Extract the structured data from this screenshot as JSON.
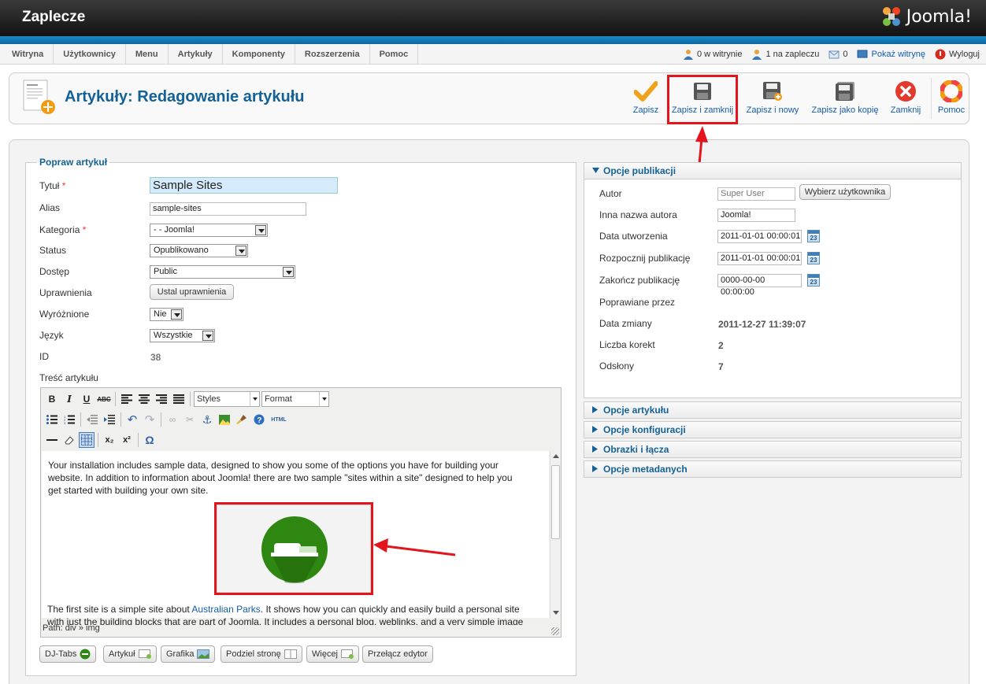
{
  "header": {
    "title": "Zaplecze",
    "logo_text": "Joomla!"
  },
  "menu": {
    "items": [
      "Witryna",
      "Użytkownicy",
      "Menu",
      "Artykuły",
      "Komponenty",
      "Rozszerzenia",
      "Pomoc"
    ]
  },
  "status": {
    "site_users": "0 w witrynie",
    "admin_users": "1 na zapleczu",
    "messages": "0",
    "show_site": "Pokaż witrynę",
    "logout": "Wyloguj"
  },
  "toolbar": {
    "page_title": "Artykuły: Redagowanie artykułu",
    "save": "Zapisz",
    "save_close": "Zapisz i zamknij",
    "save_new": "Zapisz i nowy",
    "save_copy": "Zapisz jako kopię",
    "close": "Zamknij",
    "help": "Pomoc"
  },
  "form": {
    "legend": "Popraw artykuł",
    "title_label": "Tytuł",
    "title_value": "Sample Sites",
    "alias_label": "Alias",
    "alias_value": "sample-sites",
    "category_label": "Kategoria",
    "category_value": "- - Joomla!",
    "status_label": "Status",
    "status_value": "Opublikowano",
    "access_label": "Dostęp",
    "access_value": "Public",
    "permissions_label": "Uprawnienia",
    "permissions_button": "Ustal uprawnienia",
    "featured_label": "Wyróżnione",
    "featured_value": "Nie",
    "language_label": "Język",
    "language_value": "Wszystkie",
    "id_label": "ID",
    "id_value": "38",
    "content_label": "Treść artykułu",
    "required_mark": "*"
  },
  "editor": {
    "styles": "Styles",
    "format": "Format",
    "path": "Path: div » img",
    "p1": [
      "Your installation includes sample data, designed to show you some of the options you have for building your",
      "website. In addition to information about Joomla! there are two sample \"sites within a site\" designed to help you",
      "get started with building your own site."
    ],
    "p2_before": "The first site is a simple site about ",
    "p2_link": "Australian Parks",
    "p2_after": ". It shows how you can quickly and easily build a personal site",
    "p2_line2": "with just the building blocks that are part of Joomla. It includes a personal blog, weblinks, and a very simple image"
  },
  "editor_buttons": [
    "DJ-Tabs",
    "Artykuł",
    "Grafika",
    "Podziel stronę",
    "Więcej",
    "Przełącz edytor"
  ],
  "publishing": {
    "header": "Opcje publikacji",
    "author_label": "Autor",
    "author_value": "Super User",
    "author_button": "Wybierz użytkownika",
    "alias_author_label": "Inna nazwa autora",
    "alias_author_value": "Joomla!",
    "created_label": "Data utworzenia",
    "created_value": "2011-01-01 00:00:01",
    "publish_up_label": "Rozpocznij publikację",
    "publish_up_value": "2011-01-01 00:00:01",
    "publish_down_label": "Zakończ publikację",
    "publish_down_value": "0000-00-00 00:00:00",
    "modified_by_label": "Poprawiane przez",
    "modified_label": "Data zmiany",
    "modified_value": "2011-12-27 11:39:07",
    "revisions_label": "Liczba korekt",
    "revisions_value": "2",
    "hits_label": "Odsłony",
    "hits_value": "7",
    "calendar_day": "23"
  },
  "accordion": [
    "Opcje artykułu",
    "Opcje konfiguracji",
    "Obrazki i łącza",
    "Opcje metadanych"
  ],
  "colors": {
    "accent": "#146295",
    "link": "#135cae",
    "highlight": "#e3141b",
    "header_bar": "#0b67a0"
  }
}
